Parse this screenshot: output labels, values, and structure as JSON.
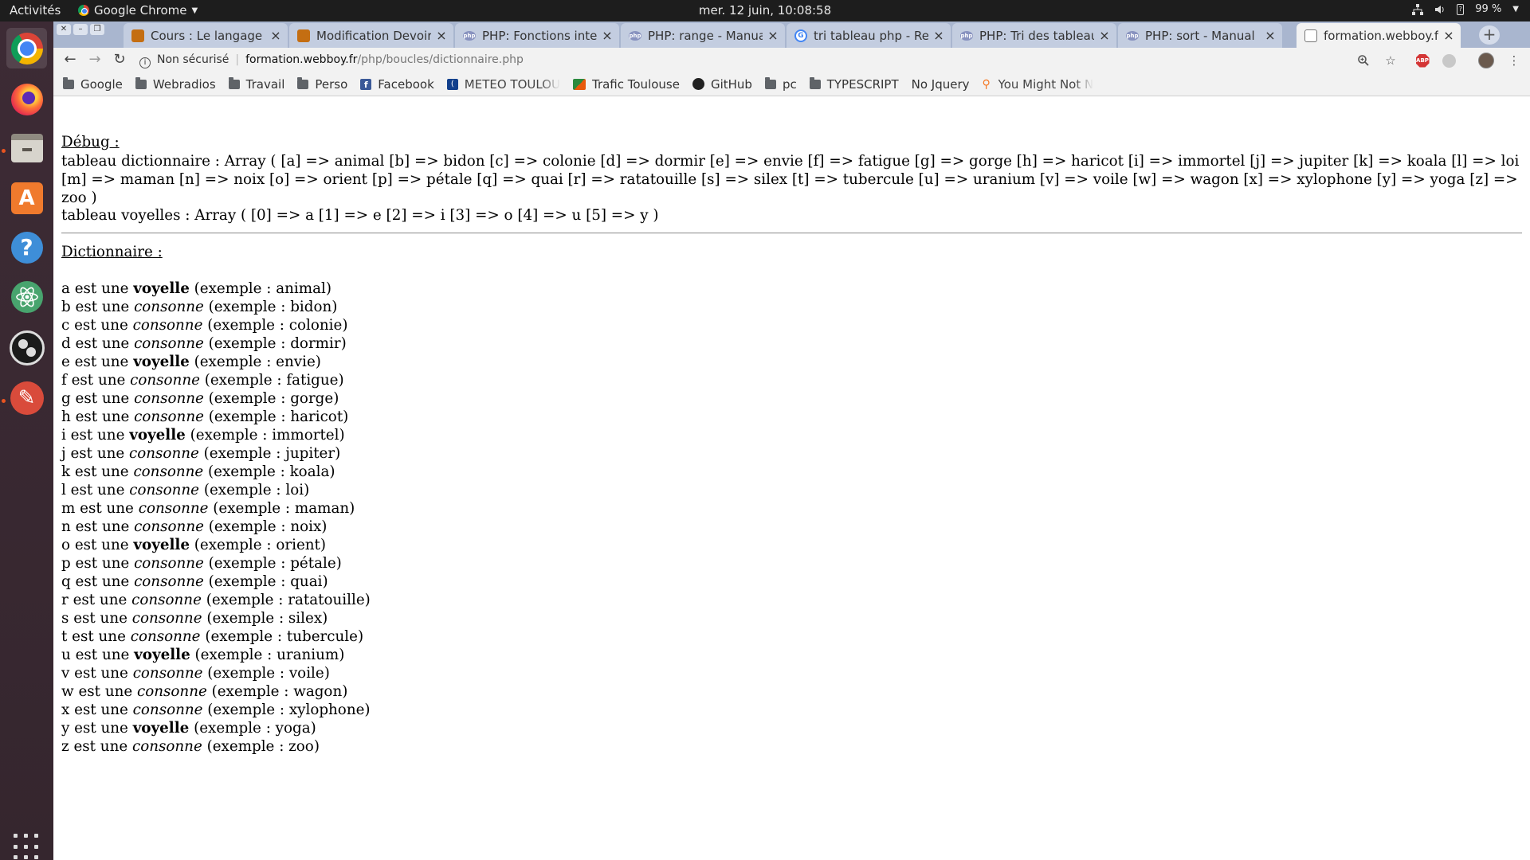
{
  "topbar": {
    "activities": "Activités",
    "app_name": "Google Chrome",
    "clock": "mer. 12 juin, 10:08:58",
    "battery": "99 %"
  },
  "dock": {
    "items": [
      "chrome",
      "firefox",
      "files",
      "ubuntu-software",
      "help",
      "atom",
      "obs-studio",
      "tools",
      "show-applications"
    ]
  },
  "tabs": [
    {
      "title": "Cours : Le langage PH",
      "favicon": "cours"
    },
    {
      "title": "Modification Devoir",
      "favicon": "cours"
    },
    {
      "title": "PHP: Fonctions intern",
      "favicon": "php"
    },
    {
      "title": "PHP: range - Manual",
      "favicon": "php"
    },
    {
      "title": "tri tableau php - Rech",
      "favicon": "google"
    },
    {
      "title": "PHP: Tri des tableaux",
      "favicon": "php"
    },
    {
      "title": "PHP: sort - Manual",
      "favicon": "php"
    },
    {
      "title": "formation.webboy.fr",
      "favicon": "doc",
      "active": true
    }
  ],
  "toolbar": {
    "security_label": "Non sécurisé",
    "url_host": "formation.webboy.fr",
    "url_path": "/php/boucles/dictionnaire.php"
  },
  "bookmarks": [
    {
      "label": "Google",
      "icon": "folder"
    },
    {
      "label": "Webradios",
      "icon": "folder"
    },
    {
      "label": "Travail",
      "icon": "folder"
    },
    {
      "label": "Perso",
      "icon": "folder"
    },
    {
      "label": "Facebook",
      "icon": "facebook"
    },
    {
      "label": "METEO TOULOU",
      "icon": "meteo"
    },
    {
      "label": "Trafic Toulouse",
      "icon": "trafic"
    },
    {
      "label": "GitHub",
      "icon": "github"
    },
    {
      "label": "pc",
      "icon": "folder"
    },
    {
      "label": "TYPESCRIPT",
      "icon": "folder"
    },
    {
      "label": "No Jquery",
      "icon": "page"
    },
    {
      "label": "You Might Not N",
      "icon": "hubspot"
    }
  ],
  "page": {
    "debug_title": "Débug :",
    "debug_dictionnaire": "tableau dictionnaire : Array ( [a] => animal [b] => bidon [c] => colonie [d] => dormir [e] => envie [f] => fatigue [g] => gorge [h] => haricot [i] => immortel [j] => jupiter [k] => koala [l] => loi [m] => maman [n] => noix [o] => orient [p] => pétale [q] => quai [r] => ratatouille [s] => silex [t] => tubercule [u] => uranium [v] => voile [w] => wagon [x] => xylophone [y] => yoga [z] => zoo )",
    "debug_voyelles": "tableau voyelles : Array ( [0] => a [1] => e [2] => i [3] => o [4] => u [5] => y )",
    "dict_title": "Dictionnaire :",
    "est_une": "est une",
    "exemple_prefix": "(exemple : ",
    "exemple_suffix": ")",
    "entries": [
      {
        "letter": "a",
        "type": "voyelle",
        "word": "animal"
      },
      {
        "letter": "b",
        "type": "consonne",
        "word": "bidon"
      },
      {
        "letter": "c",
        "type": "consonne",
        "word": "colonie"
      },
      {
        "letter": "d",
        "type": "consonne",
        "word": "dormir"
      },
      {
        "letter": "e",
        "type": "voyelle",
        "word": "envie"
      },
      {
        "letter": "f",
        "type": "consonne",
        "word": "fatigue"
      },
      {
        "letter": "g",
        "type": "consonne",
        "word": "gorge"
      },
      {
        "letter": "h",
        "type": "consonne",
        "word": "haricot"
      },
      {
        "letter": "i",
        "type": "voyelle",
        "word": "immortel"
      },
      {
        "letter": "j",
        "type": "consonne",
        "word": "jupiter"
      },
      {
        "letter": "k",
        "type": "consonne",
        "word": "koala"
      },
      {
        "letter": "l",
        "type": "consonne",
        "word": "loi"
      },
      {
        "letter": "m",
        "type": "consonne",
        "word": "maman"
      },
      {
        "letter": "n",
        "type": "consonne",
        "word": "noix"
      },
      {
        "letter": "o",
        "type": "voyelle",
        "word": "orient"
      },
      {
        "letter": "p",
        "type": "consonne",
        "word": "pétale"
      },
      {
        "letter": "q",
        "type": "consonne",
        "word": "quai"
      },
      {
        "letter": "r",
        "type": "consonne",
        "word": "ratatouille"
      },
      {
        "letter": "s",
        "type": "consonne",
        "word": "silex"
      },
      {
        "letter": "t",
        "type": "consonne",
        "word": "tubercule"
      },
      {
        "letter": "u",
        "type": "voyelle",
        "word": "uranium"
      },
      {
        "letter": "v",
        "type": "consonne",
        "word": "voile"
      },
      {
        "letter": "w",
        "type": "consonne",
        "word": "wagon"
      },
      {
        "letter": "x",
        "type": "consonne",
        "word": "xylophone"
      },
      {
        "letter": "y",
        "type": "voyelle",
        "word": "yoga"
      },
      {
        "letter": "z",
        "type": "consonne",
        "word": "zoo"
      }
    ]
  },
  "colors": {
    "topbar_bg": "#1d1d1d",
    "dock_bg": "#3b2a33",
    "tabstrip_bg": "#a9b6cf",
    "toolbar_bg": "#f2f2f2"
  }
}
